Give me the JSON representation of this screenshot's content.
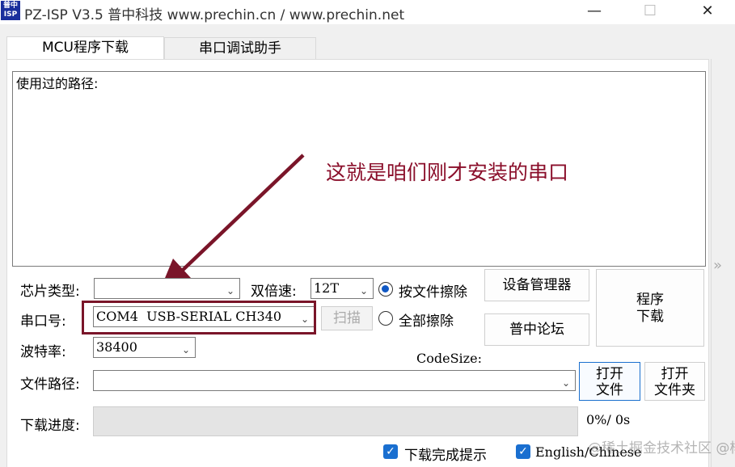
{
  "window": {
    "icon_text_top": "普中",
    "icon_text_bottom": "ISP",
    "title": "PZ-ISP V3.5 普中科技  www.prechin.cn / www.prechin.net",
    "minimize": "—",
    "maximize": "☐",
    "close": "✕"
  },
  "tabs": [
    {
      "label": "MCU程序下载",
      "active": true
    },
    {
      "label": "串口调试助手",
      "active": false
    }
  ],
  "path_panel": {
    "label": "使用过的路径:"
  },
  "annotation": {
    "text": "这就是咱们刚才安装的串口",
    "color": "#8a0e2a"
  },
  "form": {
    "chip_type_label": "芯片类型:",
    "chip_type_value": "",
    "double_speed_label": "双倍速:",
    "double_speed_value": "12T",
    "port_label": "串口号:",
    "port_value": "COM4  USB-SERIAL CH340",
    "scan_button": "扫描",
    "baud_label": "波特率:",
    "baud_value": "38400",
    "codesize_label": "CodeSize:",
    "file_path_label": "文件路径:",
    "file_path_value": "",
    "progress_label": "下载进度:",
    "progress_fraction": 0,
    "progress_text": "0%/ 0s"
  },
  "erase_options": [
    {
      "label": "按文件擦除",
      "selected": true
    },
    {
      "label": "全部擦除",
      "selected": false
    }
  ],
  "buttons": {
    "device_manager": "设备管理器",
    "forum": "普中论坛",
    "download_line1": "程序",
    "download_line2": "下载",
    "open_file_line1": "打开",
    "open_file_line2": "文件",
    "open_folder_line1": "打开",
    "open_folder_line2": "文件夹"
  },
  "checkboxes": [
    {
      "label": "下载完成提示",
      "checked": true
    },
    {
      "label": "English/Chinese",
      "checked": true
    }
  ],
  "side_toggle": "»",
  "watermark": "@稀土掘金技术社区 @杨校",
  "colors": {
    "accent": "#1a6fd0",
    "annotation": "#8a0e2a"
  }
}
